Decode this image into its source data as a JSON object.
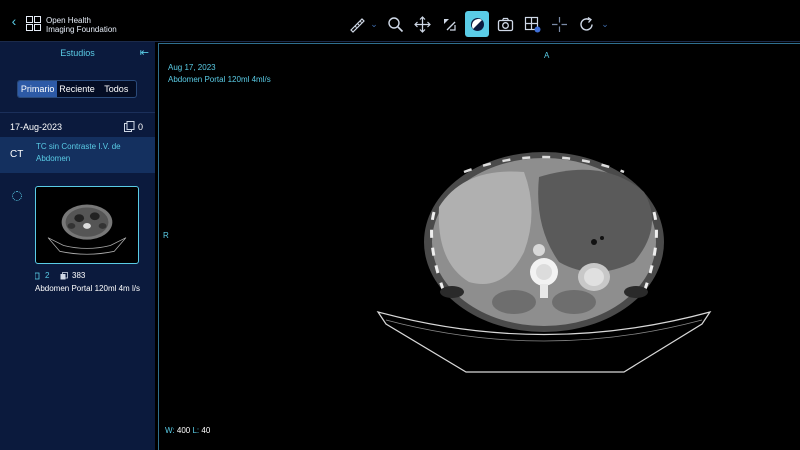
{
  "header": {
    "brand_line1": "Open Health",
    "brand_line2": "Imaging Foundation"
  },
  "toolbar": {
    "tools": [
      "measure-ruler-icon",
      "zoom-icon",
      "pan-icon",
      "window-level-icon",
      "contrast-icon",
      "capture-camera-icon",
      "layout-grid-icon",
      "crosshair-icon",
      "rotate-icon"
    ],
    "active": "contrast-icon",
    "accent": "#5acce6"
  },
  "sidebar": {
    "title": "Estudios",
    "tabs": [
      "Primario",
      "Reciente",
      "Todos"
    ],
    "selected_tab": "Primario",
    "study": {
      "date": "17-Aug-2023",
      "count": "0",
      "modality": "CT",
      "description": "TC sin Contraste I.V. de Abdomen"
    },
    "series": {
      "series_number": "2",
      "instances": "383",
      "description": "Abdomen Portal 120ml 4m l/s"
    }
  },
  "viewport": {
    "date": "Aug 17, 2023",
    "series_desc": "Abdomen Portal 120ml 4ml/s",
    "orient_top": "A",
    "orient_left": "R",
    "window_label": "W:",
    "window_value": "400",
    "level_label": "L:",
    "level_value": "40"
  }
}
